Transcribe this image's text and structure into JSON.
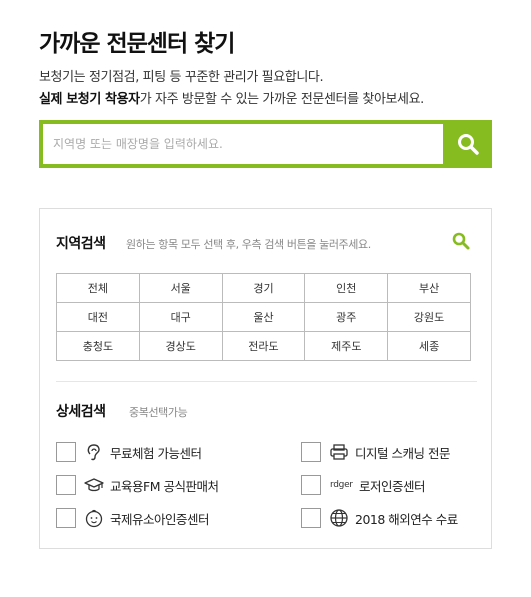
{
  "page": {
    "title": "가까운 전문센터 찾기",
    "intro_line1": "보청기는 정기점검, 피팅 등 꾸준한 관리가 필요합니다.",
    "intro_line2_bold": "실제 보청기 착용자",
    "intro_line2_rest": "가 자주 방문할 수 있는 가까운 전문센터를 찾아보세요."
  },
  "search": {
    "placeholder": "지역명 또는 매장명을 입력하세요.",
    "value": ""
  },
  "region": {
    "title": "지역검색",
    "desc": "원하는 항목 모두 선택 후, 우측 검색 버튼을 눌러주세요.",
    "rows": [
      [
        "전체",
        "서울",
        "경기",
        "인천",
        "부산"
      ],
      [
        "대전",
        "대구",
        "울산",
        "광주",
        "강원도"
      ],
      [
        "충청도",
        "경상도",
        "전라도",
        "제주도",
        "세종"
      ]
    ]
  },
  "detail": {
    "title": "상세검색",
    "desc": "중복선택가능",
    "options": [
      {
        "label": "무료체험 가능센터",
        "icon": "ear-icon"
      },
      {
        "label": "디지털 스캐닝 전문",
        "icon": "printer-icon"
      },
      {
        "label": "교육용FM 공식판매처",
        "icon": "graduation-cap-icon"
      },
      {
        "label": "로저인증센터",
        "icon": "roger-logo-icon",
        "icon_text": "rdger"
      },
      {
        "label": "국제유소아인증센터",
        "icon": "child-face-icon"
      },
      {
        "label": "2018 해외연수 수료",
        "icon": "globe-icon"
      }
    ]
  },
  "colors": {
    "accent": "#86bc1f",
    "border": "#dddddd",
    "text": "#222222"
  }
}
